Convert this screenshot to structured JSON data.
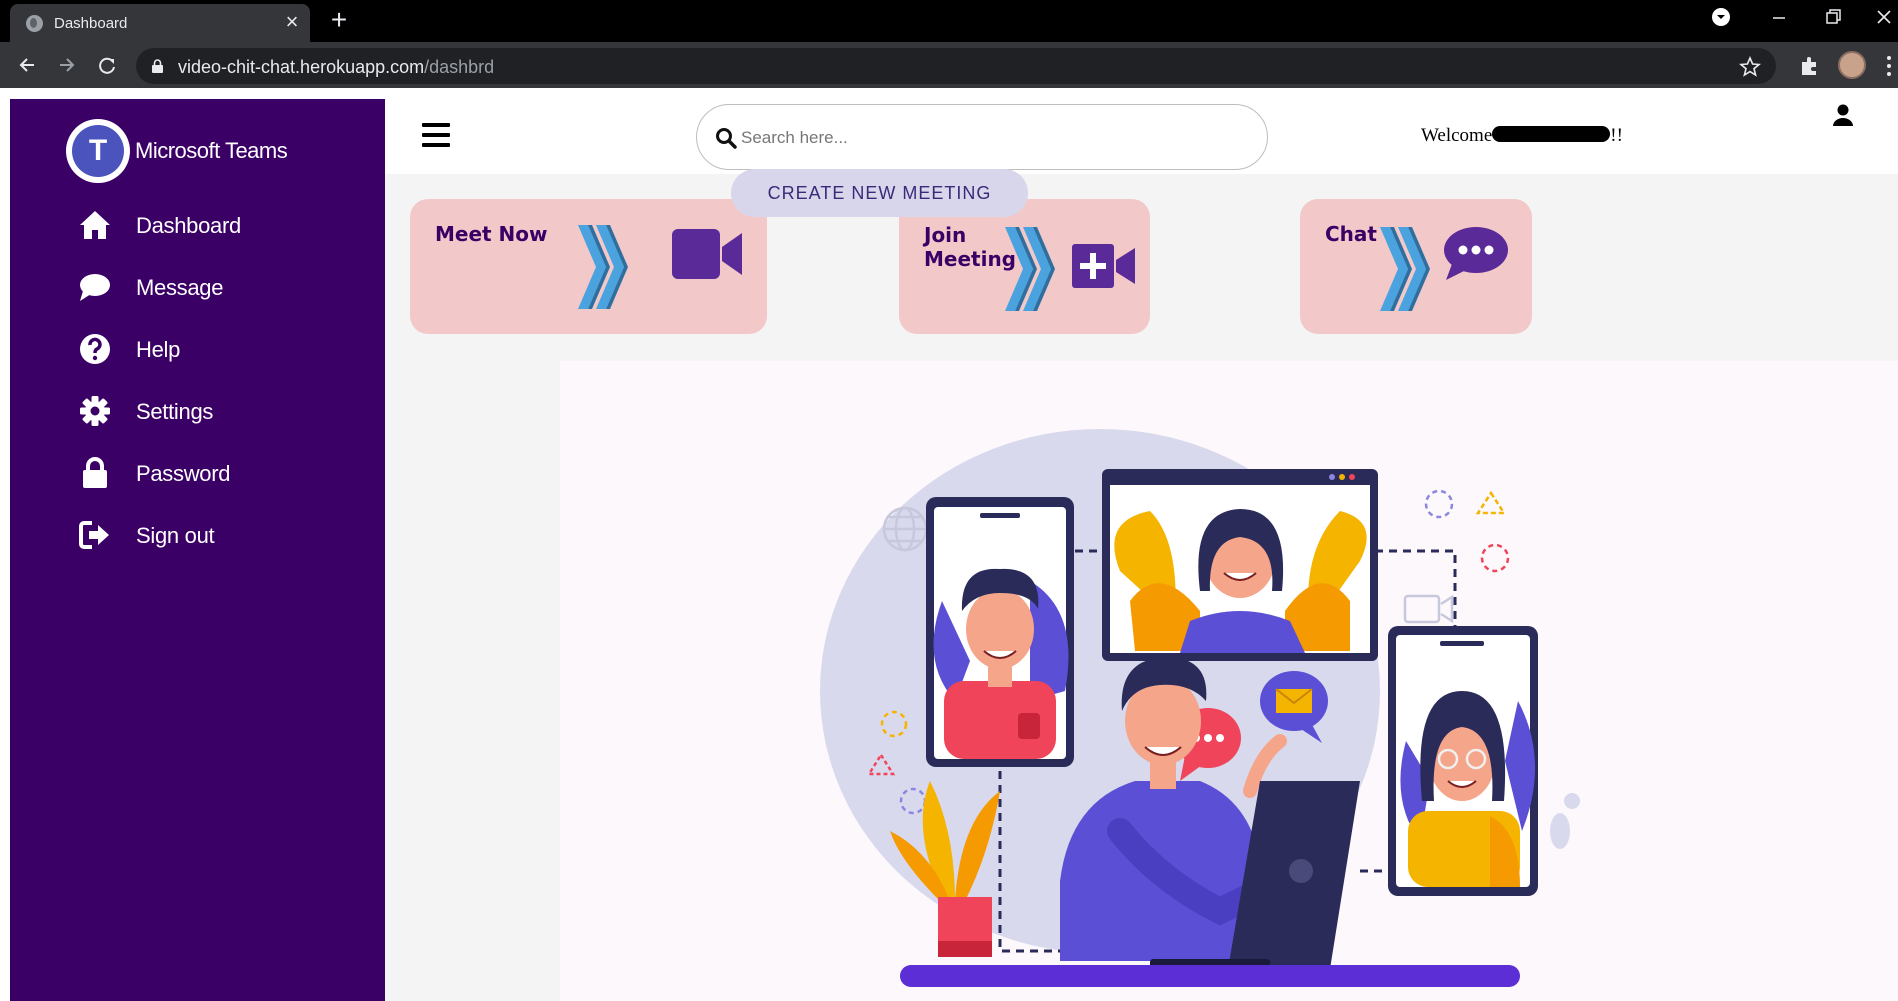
{
  "browser": {
    "tab_title": "Dashboard",
    "tab_close": "×",
    "new_tab": "+",
    "url_host": "video-chit-chat.herokuapp.com",
    "url_path": "/dashbrd"
  },
  "sidebar": {
    "brand": "Microsoft Teams",
    "logo_letter": "T",
    "items": [
      {
        "label": "Dashboard",
        "icon": "home-icon"
      },
      {
        "label": "Message",
        "icon": "chat-bubble-icon"
      },
      {
        "label": "Help",
        "icon": "question-icon"
      },
      {
        "label": "Settings",
        "icon": "gear-icon"
      },
      {
        "label": "Password",
        "icon": "lock-icon"
      },
      {
        "label": "Sign out",
        "icon": "sign-out-icon"
      }
    ]
  },
  "header": {
    "search_placeholder": "Search here...",
    "welcome_prefix": "Welcome",
    "welcome_suffix": "!!"
  },
  "actions": {
    "create_meeting": "CREATE NEW MEETING",
    "cards": [
      {
        "title": "Meet Now",
        "icon": "video-camera-icon"
      },
      {
        "title": "Join Meeting",
        "icon": "video-add-icon"
      },
      {
        "title": "Chat",
        "icon": "chat-dots-icon"
      }
    ]
  },
  "colors": {
    "sidebar_bg": "#3b0066",
    "card_bg": "#f2c8c8",
    "accent_purple": "#5b2a99",
    "chevron_blue": "#4aa3df"
  }
}
